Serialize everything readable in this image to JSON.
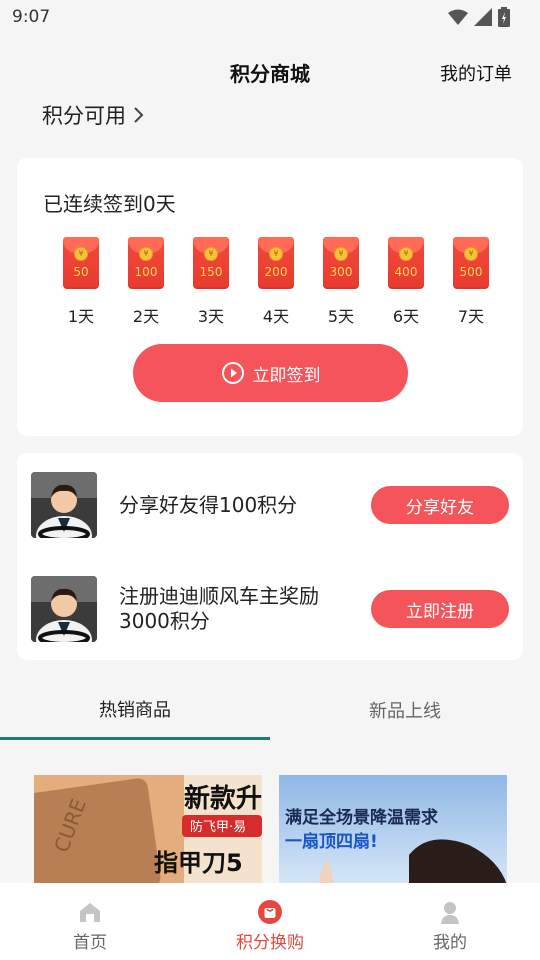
{
  "status": {
    "time": "9:07"
  },
  "header": {
    "title": "积分商城",
    "orders_label": "我的订单"
  },
  "points": {
    "label": "积分可用"
  },
  "signin": {
    "title": "已连续签到0天",
    "button_label": "立即签到",
    "days": [
      {
        "amount": "50",
        "label": "1天"
      },
      {
        "amount": "100",
        "label": "2天"
      },
      {
        "amount": "150",
        "label": "3天"
      },
      {
        "amount": "200",
        "label": "4天"
      },
      {
        "amount": "300",
        "label": "5天"
      },
      {
        "amount": "400",
        "label": "6天"
      },
      {
        "amount": "500",
        "label": "7天"
      }
    ],
    "coin_symbol": "¥"
  },
  "tasks": [
    {
      "text": "分享好友得100积分",
      "button": "分享好友"
    },
    {
      "text": "注册迪迪顺风车主奖励3000积分",
      "button": "立即注册"
    }
  ],
  "tabs": [
    {
      "label": "热销商品",
      "active": true
    },
    {
      "label": "新品上线",
      "active": false
    }
  ],
  "products": [
    {
      "banner_line1": "新款升",
      "banner_line2": "防飞甲·易",
      "banner_line3": "指甲刀5"
    },
    {
      "banner_line1": "满足全场景降温需求",
      "banner_line2": "一扇顶四扇!"
    }
  ],
  "bottom_nav": [
    {
      "label": "首页",
      "icon": "home-icon",
      "active": false
    },
    {
      "label": "积分换购",
      "icon": "shop-bag-icon",
      "active": true
    },
    {
      "label": "我的",
      "icon": "profile-icon",
      "active": false
    }
  ],
  "colors": {
    "accent": "#f4545a",
    "tab_underline": "#1e7d73",
    "nav_active": "#e8473f"
  }
}
